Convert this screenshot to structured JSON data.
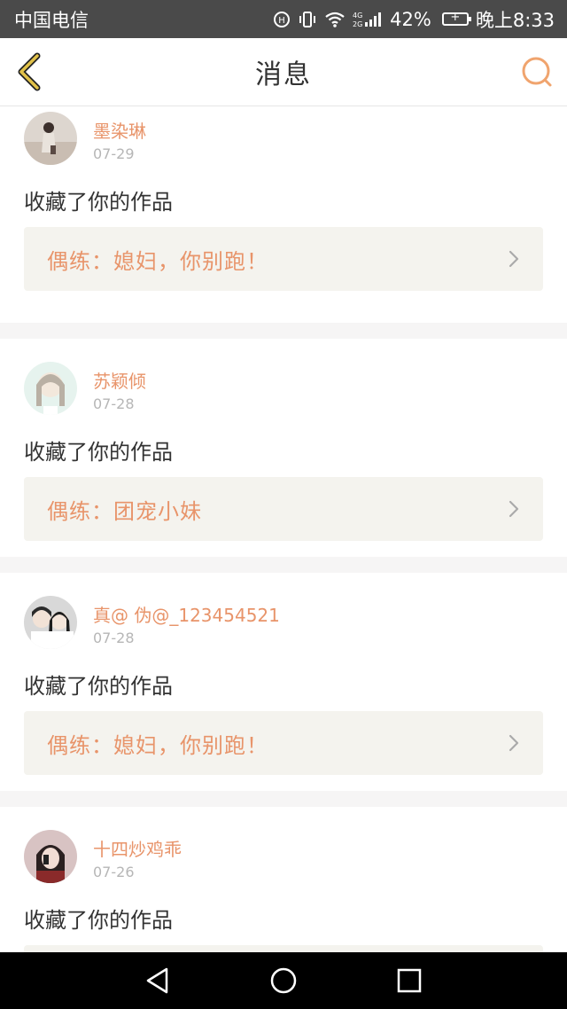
{
  "status_bar": {
    "carrier": "中国电信",
    "battery_percent": "42%",
    "time": "晚上8:33",
    "icons": [
      "hd-call-icon",
      "vibrate-icon",
      "wifi-icon",
      "signal-4g-icon",
      "battery-charging-icon"
    ]
  },
  "header": {
    "title": "消息",
    "back_icon": "back-chevron-icon",
    "search_icon": "search-icon"
  },
  "colors": {
    "accent": "#e8946a",
    "back_icon": "#e2c24a",
    "card_work_bg": "#f4f3ee",
    "page_bg": "#f6f5f5"
  },
  "messages": [
    {
      "user": "墨染琳",
      "date": "07-29",
      "action": "收藏了你的作品",
      "work_title": "偶练：媳妇，你别跑！"
    },
    {
      "user": "苏颖倾",
      "date": "07-28",
      "action": "收藏了你的作品",
      "work_title": "偶练：团宠小妹"
    },
    {
      "user": "真@ 伪@_123454521",
      "date": "07-28",
      "action": "收藏了你的作品",
      "work_title": "偶练：媳妇，你别跑！"
    },
    {
      "user": "十四炒鸡乖",
      "date": "07-26",
      "action": "收藏了你的作品",
      "work_title": ""
    }
  ],
  "nav_bar": {
    "icons": [
      "back-triangle-icon",
      "home-circle-icon",
      "recents-square-icon"
    ]
  }
}
